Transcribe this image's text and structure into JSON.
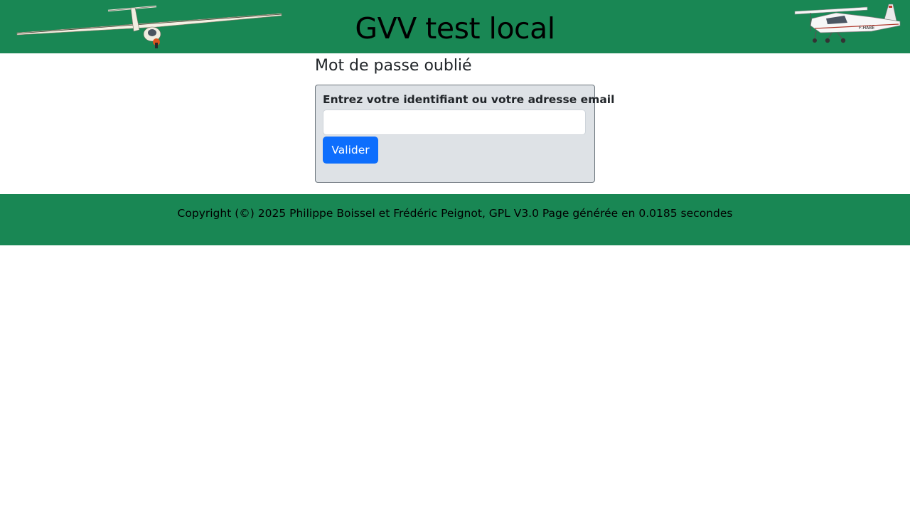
{
  "header": {
    "title": "GVV test local",
    "left_image": "glider-image",
    "right_image": "plane-image",
    "plane_registration": "F-HABE",
    "background_color": "#198754"
  },
  "main": {
    "heading": "Mot de passe oublié",
    "form": {
      "label": "Entrez votre identifiant ou votre adresse email",
      "input_value": "",
      "submit_label": "Valider",
      "button_color": "#0d6efd",
      "box_color": "#dee2e6"
    }
  },
  "footer": {
    "text": "Copyright (©) 2025 Philippe Boissel et Frédéric Peignot, GPL V3.0 Page générée en 0.0185 secondes",
    "background_color": "#198754"
  }
}
